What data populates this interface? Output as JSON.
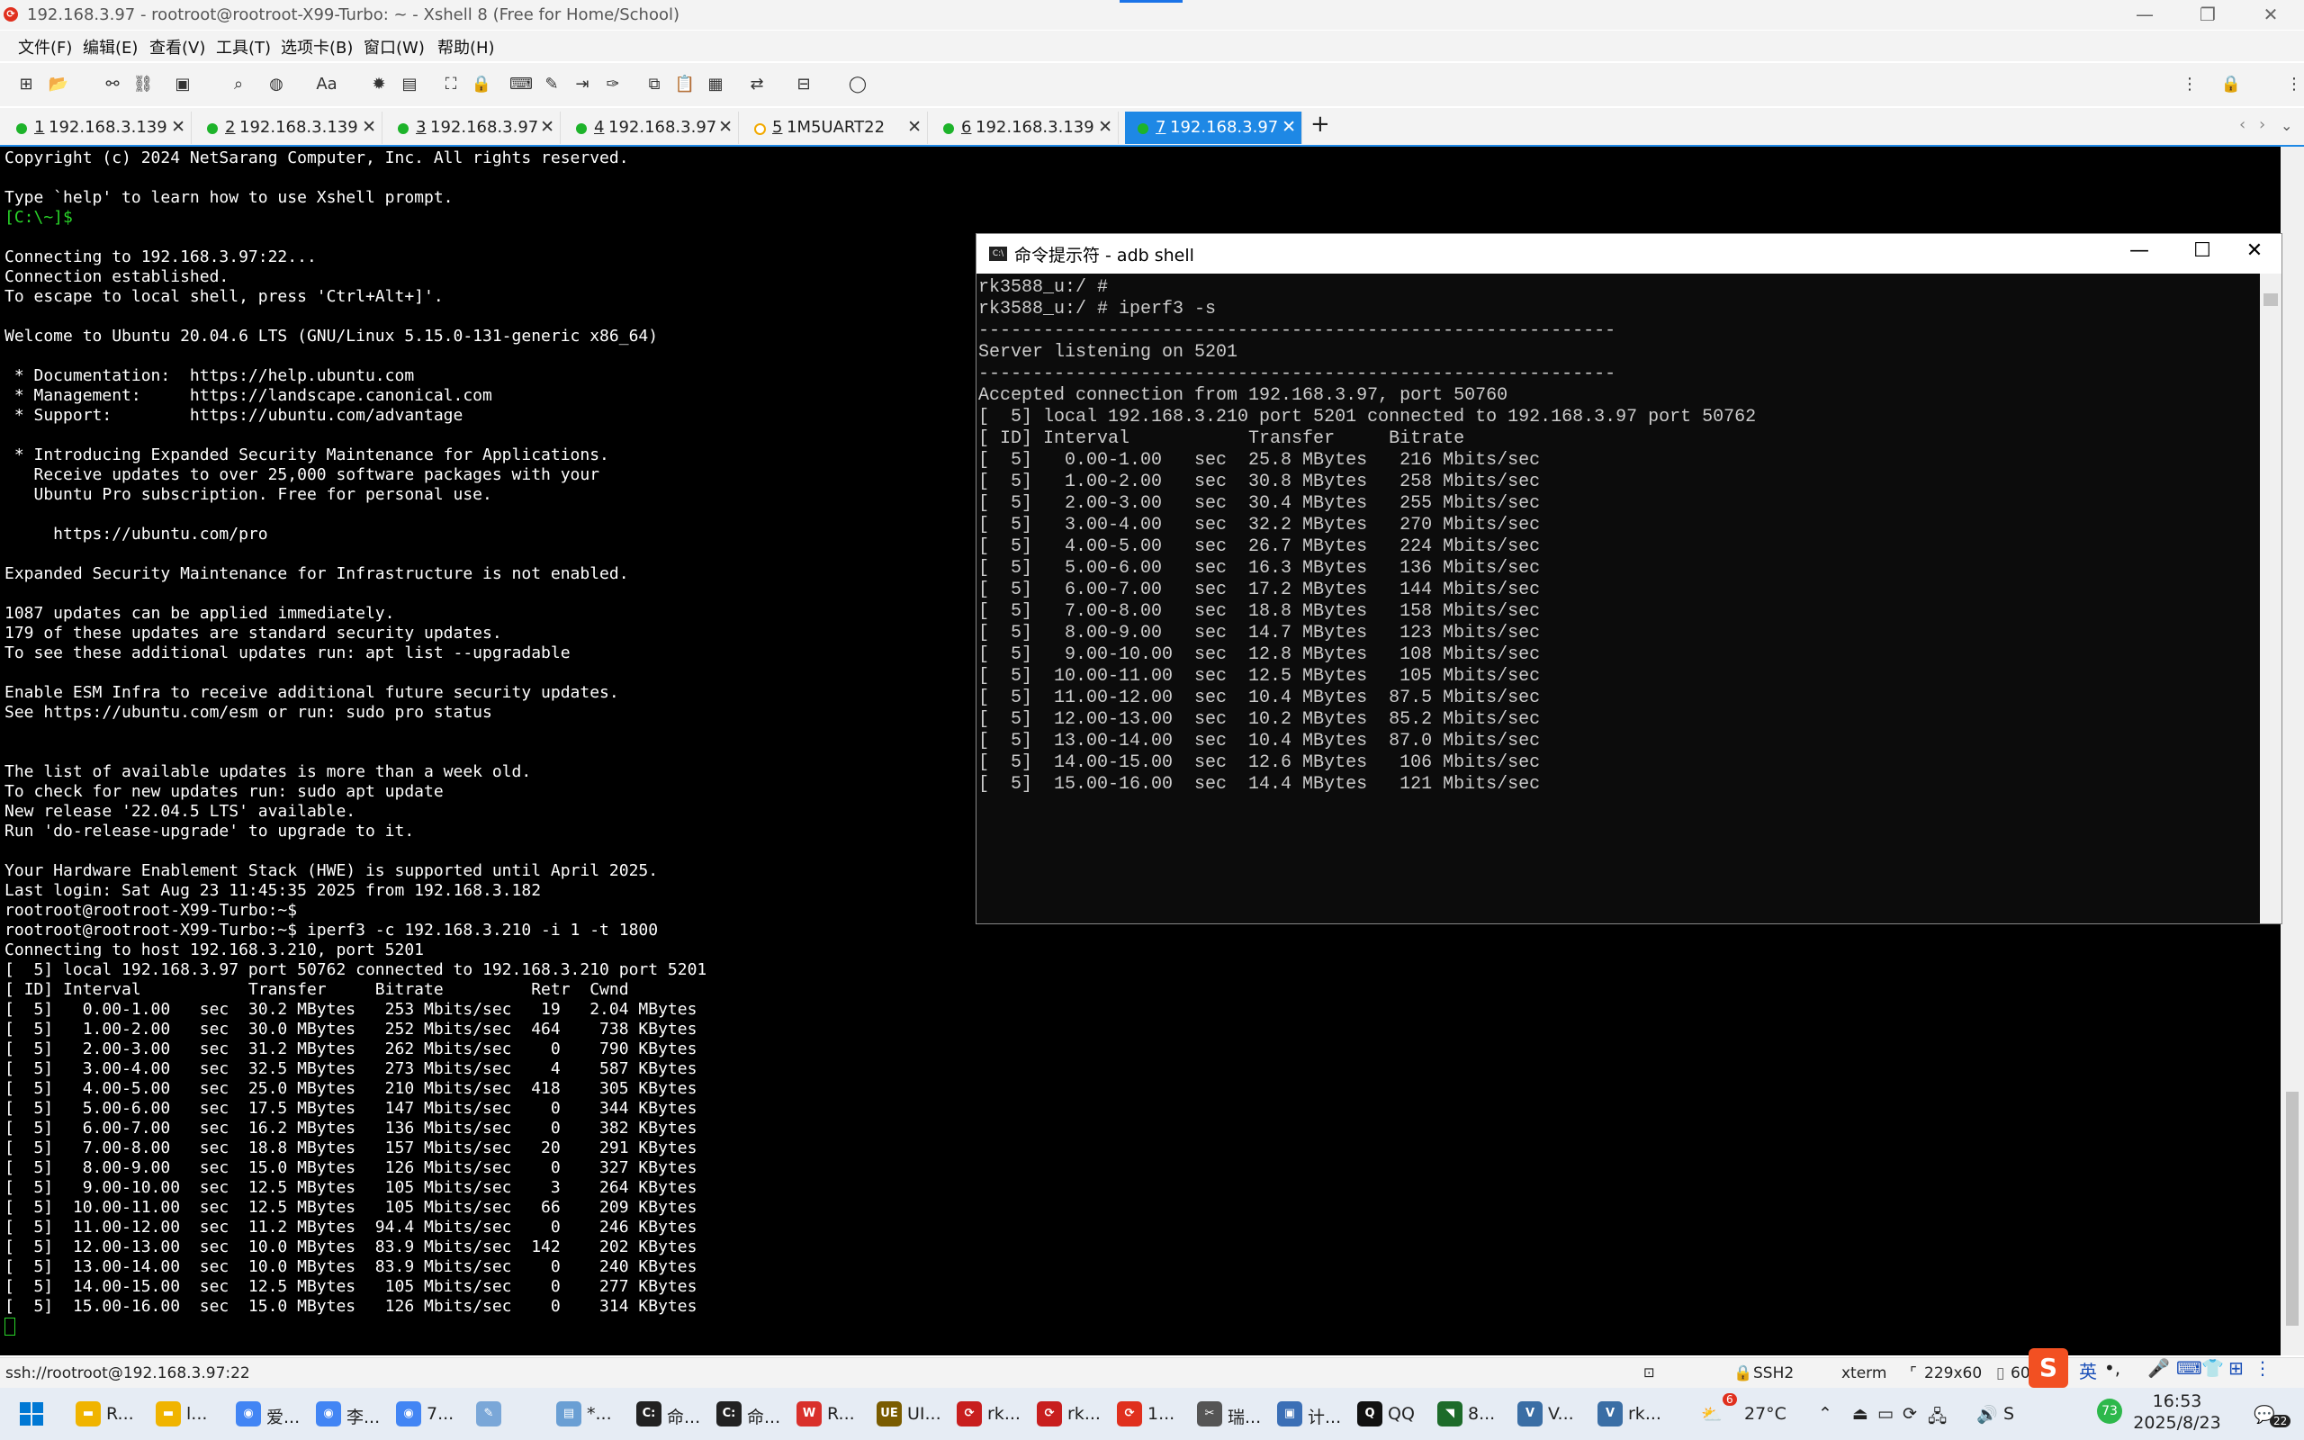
{
  "window": {
    "title": "192.168.3.97 - rootroot@rootroot-X99-Turbo: ~ - Xshell 8 (Free for Home/School)",
    "controls": {
      "minimize": "—",
      "restore": "❐",
      "close": "✕"
    }
  },
  "menu": [
    "文件(F)",
    "编辑(E)",
    "查看(V)",
    "工具(T)",
    "选项卡(B)",
    "窗口(W)",
    "帮助(H)"
  ],
  "tabs": [
    {
      "num": "1",
      "label": "192.168.3.139",
      "status": "connected"
    },
    {
      "num": "2",
      "label": "192.168.3.139",
      "status": "connected"
    },
    {
      "num": "3",
      "label": "192.168.3.97",
      "status": "connected"
    },
    {
      "num": "4",
      "label": "192.168.3.97",
      "status": "connected"
    },
    {
      "num": "5",
      "label": "1M5UART22",
      "status": "warning"
    },
    {
      "num": "6",
      "label": "192.168.3.139",
      "status": "connected"
    },
    {
      "num": "7",
      "label": "192.168.3.97",
      "status": "connected",
      "active": true
    }
  ],
  "terminal": {
    "lines": [
      "Copyright (c) 2024 NetSarang Computer, Inc. All rights reserved.",
      "",
      "Type `help' to learn how to use Xshell prompt.",
      "[C:\\~]$",
      "",
      "Connecting to 192.168.3.97:22...",
      "Connection established.",
      "To escape to local shell, press 'Ctrl+Alt+]'.",
      "",
      "Welcome to Ubuntu 20.04.6 LTS (GNU/Linux 5.15.0-131-generic x86_64)",
      "",
      " * Documentation:  https://help.ubuntu.com",
      " * Management:     https://landscape.canonical.com",
      " * Support:        https://ubuntu.com/advantage",
      "",
      " * Introducing Expanded Security Maintenance for Applications.",
      "   Receive updates to over 25,000 software packages with your",
      "   Ubuntu Pro subscription. Free for personal use.",
      "",
      "     https://ubuntu.com/pro",
      "",
      "Expanded Security Maintenance for Infrastructure is not enabled.",
      "",
      "1087 updates can be applied immediately.",
      "179 of these updates are standard security updates.",
      "To see these additional updates run: apt list --upgradable",
      "",
      "Enable ESM Infra to receive additional future security updates.",
      "See https://ubuntu.com/esm or run: sudo pro status",
      "",
      "",
      "The list of available updates is more than a week old.",
      "To check for new updates run: sudo apt update",
      "New release '22.04.5 LTS' available.",
      "Run 'do-release-upgrade' to upgrade to it.",
      "",
      "Your Hardware Enablement Stack (HWE) is supported until April 2025.",
      "Last login: Sat Aug 23 11:45:35 2025 from 192.168.3.182",
      "rootroot@rootroot-X99-Turbo:~$",
      "rootroot@rootroot-X99-Turbo:~$ iperf3 -c 192.168.3.210 -i 1 -t 1800",
      "Connecting to host 192.168.3.210, port 5201",
      "[  5] local 192.168.3.97 port 50762 connected to 192.168.3.210 port 5201",
      "[ ID] Interval           Transfer     Bitrate         Retr  Cwnd",
      "[  5]   0.00-1.00   sec  30.2 MBytes   253 Mbits/sec   19   2.04 MBytes",
      "[  5]   1.00-2.00   sec  30.0 MBytes   252 Mbits/sec  464    738 KBytes",
      "[  5]   2.00-3.00   sec  31.2 MBytes   262 Mbits/sec    0    790 KBytes",
      "[  5]   3.00-4.00   sec  32.5 MBytes   273 Mbits/sec    4    587 KBytes",
      "[  5]   4.00-5.00   sec  25.0 MBytes   210 Mbits/sec  418    305 KBytes",
      "[  5]   5.00-6.00   sec  17.5 MBytes   147 Mbits/sec    0    344 KBytes",
      "[  5]   6.00-7.00   sec  16.2 MBytes   136 Mbits/sec    0    382 KBytes",
      "[  5]   7.00-8.00   sec  18.8 MBytes   157 Mbits/sec   20    291 KBytes",
      "[  5]   8.00-9.00   sec  15.0 MBytes   126 Mbits/sec    0    327 KBytes",
      "[  5]   9.00-10.00  sec  12.5 MBytes   105 Mbits/sec    3    264 KBytes",
      "[  5]  10.00-11.00  sec  12.5 MBytes   105 Mbits/sec   66    209 KBytes",
      "[  5]  11.00-12.00  sec  11.2 MBytes  94.4 Mbits/sec    0    246 KBytes",
      "[  5]  12.00-13.00  sec  10.0 MBytes  83.9 Mbits/sec  142    202 KBytes",
      "[  5]  13.00-14.00  sec  10.0 MBytes  83.9 Mbits/sec    0    240 KBytes",
      "[  5]  14.00-15.00  sec  12.5 MBytes   105 Mbits/sec    0    277 KBytes",
      "[  5]  15.00-16.00  sec  15.0 MBytes   126 Mbits/sec    0    314 KBytes"
    ]
  },
  "cmd_window": {
    "title": "命令提示符 - adb  shell",
    "icon": "C:\\",
    "controls": {
      "minimize": "—",
      "maximize": "☐",
      "close": "✕"
    },
    "lines": [
      "rk3588_u:/ #",
      "rk3588_u:/ # iperf3 -s",
      "-----------------------------------------------------------",
      "Server listening on 5201",
      "-----------------------------------------------------------",
      "Accepted connection from 192.168.3.97, port 50760",
      "[  5] local 192.168.3.210 port 5201 connected to 192.168.3.97 port 50762",
      "[ ID] Interval           Transfer     Bitrate",
      "[  5]   0.00-1.00   sec  25.8 MBytes   216 Mbits/sec",
      "[  5]   1.00-2.00   sec  30.8 MBytes   258 Mbits/sec",
      "[  5]   2.00-3.00   sec  30.4 MBytes   255 Mbits/sec",
      "[  5]   3.00-4.00   sec  32.2 MBytes   270 Mbits/sec",
      "[  5]   4.00-5.00   sec  26.7 MBytes   224 Mbits/sec",
      "[  5]   5.00-6.00   sec  16.3 MBytes   136 Mbits/sec",
      "[  5]   6.00-7.00   sec  17.2 MBytes   144 Mbits/sec",
      "[  5]   7.00-8.00   sec  18.8 MBytes   158 Mbits/sec",
      "[  5]   8.00-9.00   sec  14.7 MBytes   123 Mbits/sec",
      "[  5]   9.00-10.00  sec  12.8 MBytes   108 Mbits/sec",
      "[  5]  10.00-11.00  sec  12.5 MBytes   105 Mbits/sec",
      "[  5]  11.00-12.00  sec  10.4 MBytes  87.5 Mbits/sec",
      "[  5]  12.00-13.00  sec  10.2 MBytes  85.2 Mbits/sec",
      "[  5]  13.00-14.00  sec  10.4 MBytes  87.0 Mbits/sec",
      "[  5]  14.00-15.00  sec  12.6 MBytes   106 Mbits/sec",
      "[  5]  15.00-16.00  sec  14.4 MBytes   121 Mbits/sec"
    ]
  },
  "statusbar": {
    "session": "ssh://rootroot@192.168.3.97:22",
    "protocol": "SSH2",
    "term": "xterm",
    "size": "229x60",
    "pos": "60,"
  },
  "taskbar": {
    "items": [
      {
        "label": "R...",
        "color": "#f0b400",
        "icon": "folder-icon"
      },
      {
        "label": "l...",
        "color": "#f0b400",
        "icon": "folder-icon"
      },
      {
        "label": "爱...",
        "color": "#4285f4",
        "icon": "chrome-icon"
      },
      {
        "label": "李...",
        "color": "#4285f4",
        "icon": "chrome-icon"
      },
      {
        "label": "7...",
        "color": "#4285f4",
        "icon": "chrome-icon"
      },
      {
        "label": "",
        "color": "#7aa7d8",
        "icon": "pen-icon"
      },
      {
        "label": "*...",
        "color": "#6a9fd4",
        "icon": "notepad-icon"
      },
      {
        "label": "命...",
        "color": "#222222",
        "icon": "cmd-icon"
      },
      {
        "label": "命...",
        "color": "#222222",
        "icon": "cmd-icon"
      },
      {
        "label": "R...",
        "color": "#d9302b",
        "icon": "wps-icon"
      },
      {
        "label": "UI...",
        "color": "#7a5c00",
        "icon": "ue-icon"
      },
      {
        "label": "rk...",
        "color": "#c81e1e",
        "icon": "xshell-icon"
      },
      {
        "label": "rk...",
        "color": "#c81e1e",
        "icon": "xshell-icon"
      },
      {
        "label": "1...",
        "color": "#e0301e",
        "icon": "xshell-icon"
      },
      {
        "label": "瑞...",
        "color": "#555555",
        "icon": "tool-icon"
      },
      {
        "label": "计...",
        "color": "#3b6fb6",
        "icon": "computer-icon"
      },
      {
        "label": "QQ",
        "color": "#111111",
        "icon": "qq-icon"
      },
      {
        "label": "8...",
        "color": "#1d6b2a",
        "icon": "nvidia-icon"
      },
      {
        "label": "V...",
        "color": "#3a6ea5",
        "icon": "virtualbox-icon"
      },
      {
        "label": "rk...",
        "color": "#3a6ea5",
        "icon": "virtualbox-icon"
      }
    ],
    "weather": "27°C",
    "weather_badge": "6",
    "time": "16:53",
    "date": "2025/8/23",
    "notif_count": "22",
    "ime_label": "英",
    "battery_badge": "73"
  }
}
